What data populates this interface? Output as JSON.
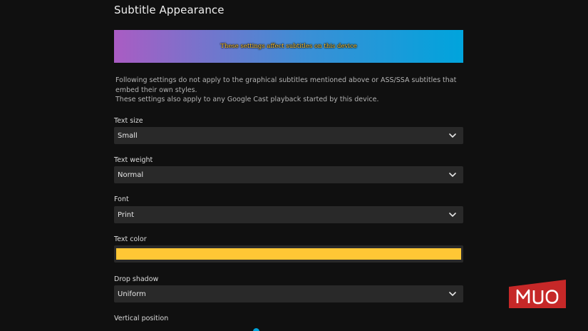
{
  "section": {
    "title": "Subtitle Appearance"
  },
  "preview": {
    "text": "These settings affect subtitles on this device",
    "gradient_start": "#aa5cc3",
    "gradient_end": "#00a4dc",
    "text_color": "#ffc735"
  },
  "info": {
    "line1": "Following settings do not apply to the graphical subtitles mentioned above or ASS/SSA subtitles that embed their own styles.",
    "line2": "These settings also apply to any Google Cast playback started by this device."
  },
  "fields": {
    "text_size": {
      "label": "Text size",
      "value": "Small"
    },
    "text_weight": {
      "label": "Text weight",
      "value": "Normal"
    },
    "font": {
      "label": "Font",
      "value": "Print"
    },
    "text_color": {
      "label": "Text color",
      "value": "#ffc735"
    },
    "drop_shadow": {
      "label": "Drop shadow",
      "value": "Uniform"
    },
    "vertical_position": {
      "label": "Vertical position"
    }
  },
  "watermark": {
    "text": "MUO",
    "color": "#c62828"
  },
  "icons": {
    "dropdown": "chevron-down-icon"
  }
}
